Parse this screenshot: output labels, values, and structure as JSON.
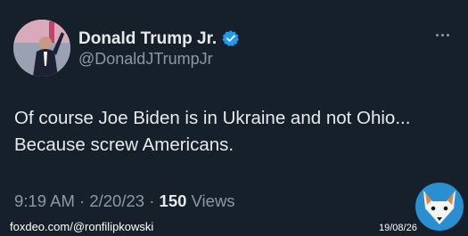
{
  "author": {
    "name": "Donald Trump Jr.",
    "handle": "@DonaldJTrumpJr",
    "verified": true
  },
  "tweet": {
    "lines": [
      "Of course Joe Biden is in Ukraine and not Ohio...",
      "Because screw Americans."
    ]
  },
  "meta": {
    "time": "9:19 AM",
    "sep1": "·",
    "date": "2/20/23",
    "sep2": "·",
    "view_count": "150",
    "views_label": "Views"
  },
  "watermark": {
    "source": "foxdeo.com/@ronfilipkowski",
    "date": "19/08/26"
  },
  "icons": {
    "more": "more-horizontal-icon",
    "verified": "verified-badge-icon",
    "logo": "fox-logo-icon"
  },
  "colors": {
    "background": "#15202b",
    "text": "#e7e9ea",
    "secondary": "#8b98a5",
    "verified": "#1d9bf0"
  }
}
